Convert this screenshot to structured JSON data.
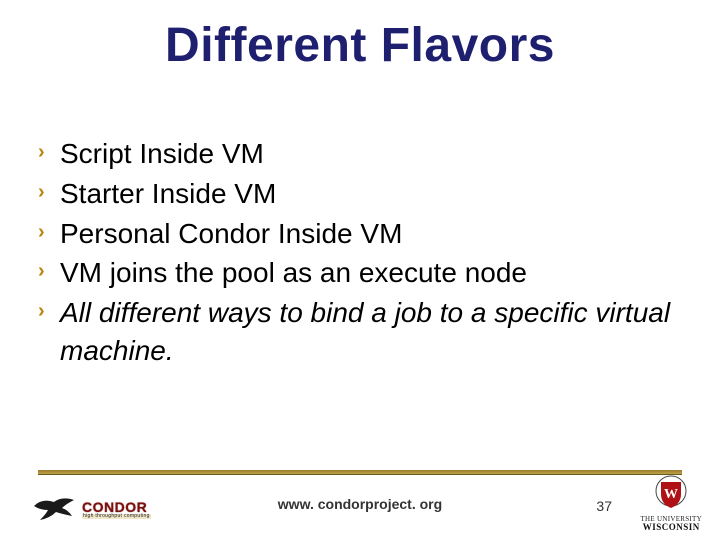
{
  "title": "Different Flavors",
  "bullets": [
    {
      "text": "Script Inside VM",
      "italic": false
    },
    {
      "text": "Starter Inside VM",
      "italic": false
    },
    {
      "text": "Personal Condor Inside VM",
      "italic": false
    },
    {
      "text": "VM joins the pool as an execute node",
      "italic": false
    },
    {
      "text": "All different ways to bind a job to a specific virtual machine.",
      "italic": true
    }
  ],
  "footer": {
    "url": "www. condorproject. org",
    "page": "37",
    "left_logo": {
      "wordmark": "CONDOR",
      "tagline": "high throughput computing"
    },
    "right_logo": {
      "top": "THE UNIVERSITY",
      "bottom": "WISCONSIN"
    }
  },
  "glyphs": {
    "chevron": "›"
  },
  "colors": {
    "title": "#1f1f6f",
    "accent": "#b7860b",
    "crest": "#b01116"
  }
}
